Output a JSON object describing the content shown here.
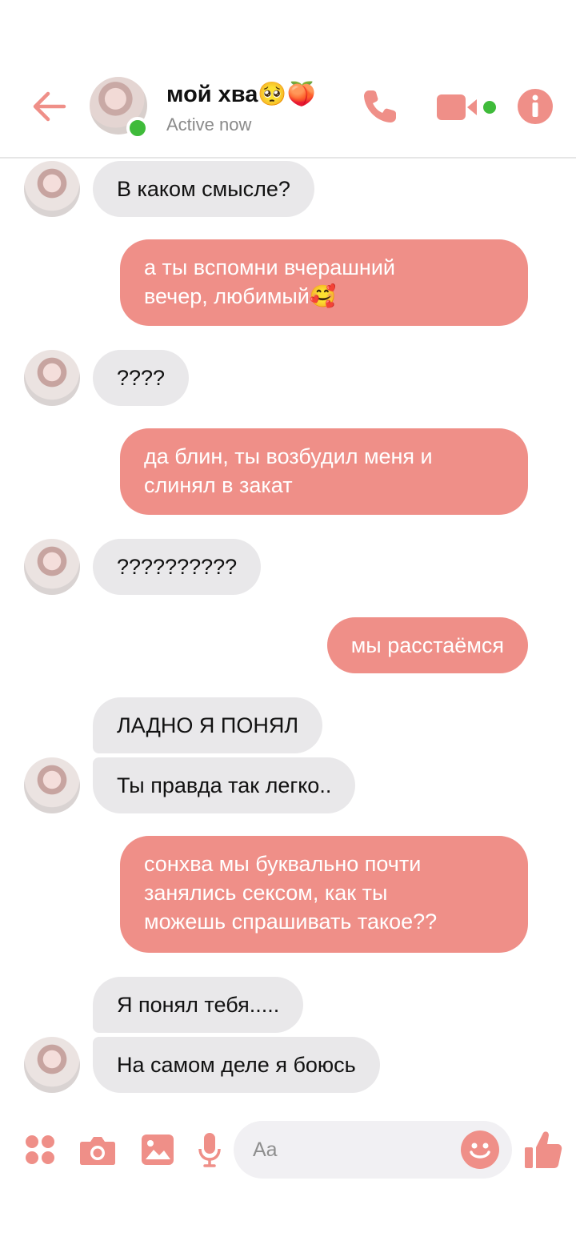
{
  "header": {
    "name": "мой хва🥺🍑",
    "status": "Active now"
  },
  "messages": [
    {
      "side": "in",
      "text": "В каком смысле?"
    },
    {
      "side": "out",
      "text": "а ты вспомни вчерашний\nвечер, любимый🥰"
    },
    {
      "side": "in",
      "text": "????"
    },
    {
      "side": "out",
      "text": "да блин, ты возбудил меня и\nслинял в закат"
    },
    {
      "side": "in",
      "text": "??????????"
    },
    {
      "side": "out",
      "text": "мы расстаёмся"
    },
    {
      "side": "in",
      "text": "ЛАДНО Я ПОНЯЛ"
    },
    {
      "side": "in",
      "text": "Ты правда так легко.."
    },
    {
      "side": "out",
      "text": "сонхва мы буквально почти\nзанялись сексом, как ты\nможешь спрашивать такое??"
    },
    {
      "side": "in",
      "text": "Я понял тебя....."
    },
    {
      "side": "in",
      "text": "На самом деле я боюсь"
    }
  ],
  "composer": {
    "placeholder": "Aa"
  },
  "icons": {
    "accent": "#ef8f88",
    "online": "#3fbb3a",
    "names": [
      "back-arrow-icon",
      "phone-icon",
      "video-camera-icon",
      "info-icon",
      "apps-icon",
      "camera-icon",
      "image-icon",
      "microphone-icon",
      "emoji-icon",
      "thumbs-up-icon"
    ]
  }
}
